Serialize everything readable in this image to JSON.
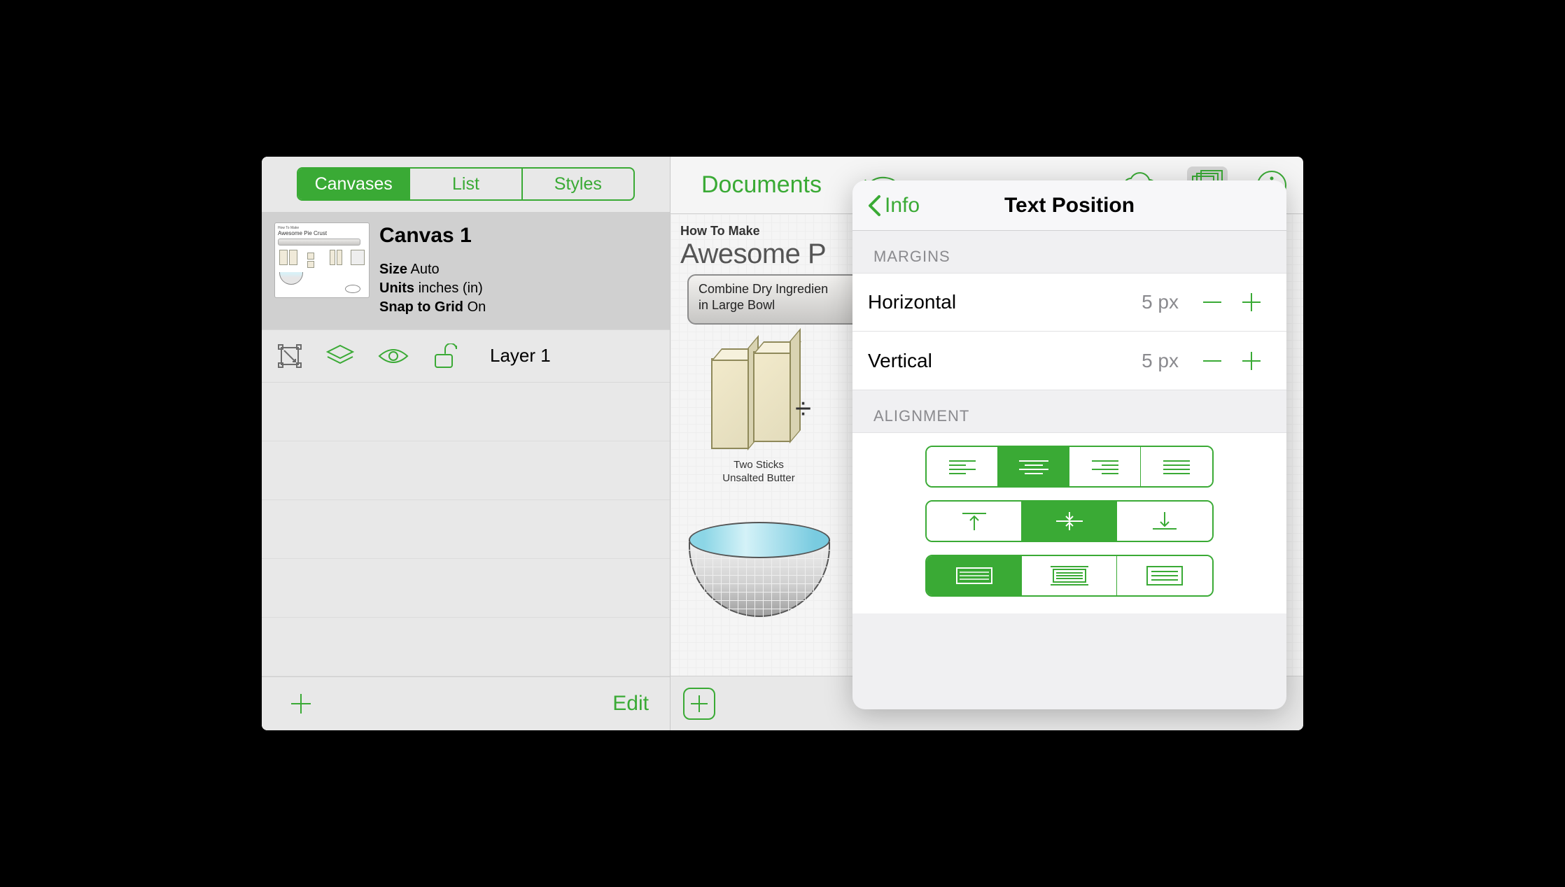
{
  "sidebar": {
    "tabs": {
      "canvases": "Canvases",
      "list": "List",
      "styles": "Styles"
    },
    "canvas": {
      "name": "Canvas 1",
      "size_label": "Size",
      "size_value": "Auto",
      "units_label": "Units",
      "units_value": "inches (in)",
      "snap_label": "Snap to Grid",
      "snap_value": "On"
    },
    "layer_name": "Layer 1",
    "edit_label": "Edit"
  },
  "topbar": {
    "title": "Documents"
  },
  "doc": {
    "small_title": "How To Make",
    "big_title": "Awesome P",
    "step_line1": "Combine Dry Ingredien",
    "step_line2": "in Large Bowl",
    "butter_caption1": "Two Sticks",
    "butter_caption2": "Unsalted Butter"
  },
  "popover": {
    "back_label": "Info",
    "title": "Text Position",
    "margins_label": "MARGINS",
    "horizontal_label": "Horizontal",
    "horizontal_value": "5 px",
    "vertical_label": "Vertical",
    "vertical_value": "5 px",
    "alignment_label": "ALIGNMENT"
  }
}
